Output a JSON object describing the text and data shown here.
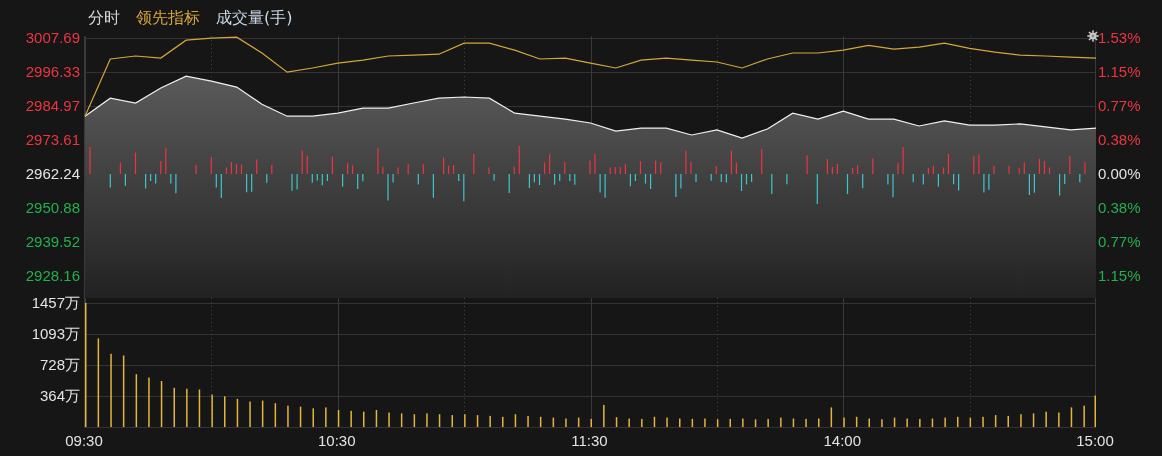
{
  "legend": [
    {
      "label": "分时",
      "color": "#d8d8d8"
    },
    {
      "label": "领先指标",
      "color": "#d4a73a"
    },
    {
      "label": "成交量(手)",
      "color": "#c8d8e8"
    }
  ],
  "price_chart": {
    "chart_data": {
      "type": "area",
      "grid": true,
      "ylim": [
        2920.8,
        3008.4
      ],
      "yticks": [
        {
          "value": 3007.69,
          "label": "3007.69"
        },
        {
          "value": 2996.33,
          "label": "2996.33"
        },
        {
          "value": 2984.97,
          "label": "2984.97"
        },
        {
          "value": 2973.61,
          "label": "2973.61"
        },
        {
          "value": 2962.24,
          "label": "2962.24"
        },
        {
          "value": 2950.88,
          "label": "2950.88"
        },
        {
          "value": 2939.52,
          "label": "2939.52"
        },
        {
          "value": 2928.16,
          "label": "2928.16"
        }
      ],
      "series": [
        {
          "type": "area",
          "color": "#f0f0f0",
          "values": [
            2981.6,
            2987.6,
            2986.0,
            2991.0,
            2995.0,
            2993.3,
            2991.3,
            2985.6,
            2981.6,
            2981.6,
            2982.6,
            2984.3,
            2984.3,
            2986.0,
            2987.6,
            2988.0,
            2987.6,
            2982.6,
            2981.6,
            2980.6,
            2979.3,
            2976.6,
            2977.6,
            2977.6,
            2975.3,
            2977.0,
            2974.3,
            2977.3,
            2982.6,
            2980.6,
            2983.3,
            2980.6,
            2980.6,
            2978.3,
            2980.0,
            2978.6,
            2978.6,
            2979.0,
            2978.0,
            2977.0,
            2977.6
          ]
        },
        {
          "type": "line",
          "color": "#d4a73a",
          "values": [
            2981.6,
            3000.7,
            3001.7,
            3001.0,
            3007.0,
            3007.7,
            3008.0,
            3002.7,
            2996.3,
            2997.7,
            2999.3,
            3000.3,
            3001.7,
            3002.0,
            3002.3,
            3006.0,
            3006.0,
            3003.7,
            3000.7,
            3001.0,
            2999.3,
            2997.7,
            3000.3,
            3001.0,
            3000.3,
            2999.7,
            2997.7,
            3000.7,
            3002.7,
            3002.7,
            3003.7,
            3005.3,
            3004.0,
            3004.7,
            3006.0,
            3004.3,
            3003.0,
            3002.0,
            3001.7,
            3001.3,
            3001.0
          ]
        }
      ]
    }
  },
  "percent_labels": [
    {
      "label": "1.53%",
      "color": "#ec3540"
    },
    {
      "label": "1.15%",
      "color": "#ec3540"
    },
    {
      "label": "0.77%",
      "color": "#ec3540"
    },
    {
      "label": "0.38%",
      "color": "#ec3540"
    },
    {
      "label": "0.00%",
      "color": "#e4e4e4"
    },
    {
      "label": "0.38%",
      "color": "#22b14c"
    },
    {
      "label": "0.77%",
      "color": "#22b14c"
    },
    {
      "label": "1.15%",
      "color": "#22b14c"
    }
  ],
  "volume_chart": {
    "chart_data": {
      "type": "bar",
      "grid": true,
      "ylim": [
        0,
        1515
      ],
      "categories": [
        "09:30",
        null,
        null,
        null,
        null,
        null,
        null,
        null,
        null,
        null,
        null,
        null,
        null,
        null,
        null,
        null,
        null,
        null,
        null,
        null,
        "10:30",
        null,
        null,
        null,
        null,
        null,
        null,
        null,
        null,
        null,
        null,
        null,
        null,
        null,
        null,
        null,
        null,
        null,
        null,
        null,
        "11:30",
        null,
        null,
        null,
        null,
        null,
        null,
        null,
        null,
        null,
        null,
        null,
        null,
        null,
        null,
        null,
        null,
        null,
        null,
        null,
        "14:00",
        null,
        null,
        null,
        null,
        null,
        null,
        null,
        null,
        null,
        null,
        null,
        null,
        null,
        null,
        null,
        null,
        null,
        null,
        null,
        "15:00"
      ],
      "yticks": [
        {
          "value": 1457,
          "label": "1457万"
        },
        {
          "value": 1093,
          "label": "1093万"
        },
        {
          "value": 728,
          "label": "728万"
        },
        {
          "value": 364,
          "label": "364万"
        }
      ],
      "series": [
        {
          "color": "#e6b43a",
          "values": [
            1457,
            1040,
            860,
            840,
            620,
            580,
            540,
            460,
            450,
            440,
            380,
            360,
            330,
            300,
            310,
            280,
            250,
            240,
            220,
            230,
            200,
            190,
            180,
            200,
            170,
            160,
            150,
            160,
            150,
            140,
            150,
            140,
            130,
            120,
            150,
            130,
            120,
            110,
            100,
            110,
            95,
            260,
            115,
            100,
            95,
            120,
            110,
            100,
            95,
            100,
            90,
            95,
            100,
            90,
            95,
            110,
            100,
            95,
            100,
            230,
            110,
            120,
            100,
            90,
            110,
            100,
            95,
            100,
            110,
            120,
            110,
            120,
            140,
            130,
            150,
            160,
            180,
            170,
            230,
            250,
            370
          ]
        }
      ]
    }
  }
}
